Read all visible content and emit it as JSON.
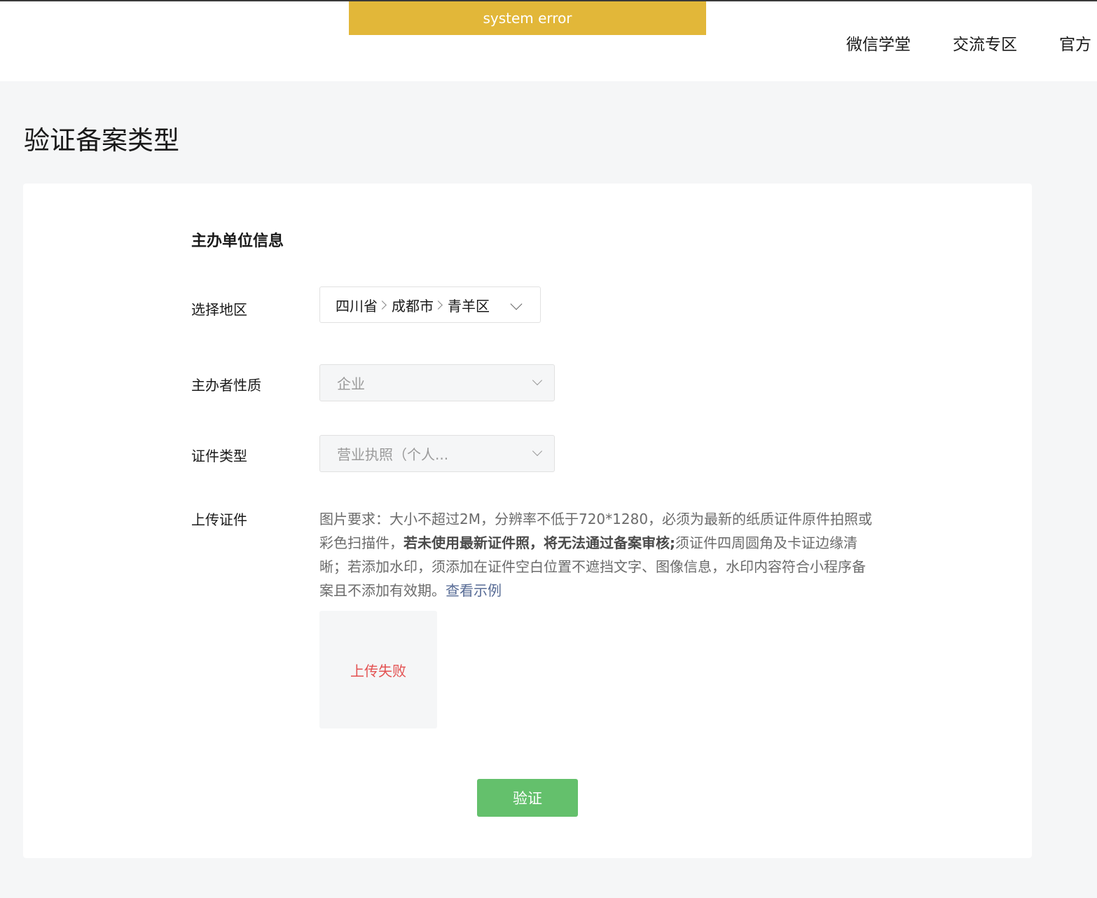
{
  "banner": {
    "text": "system error"
  },
  "nav": {
    "items": [
      "微信学堂",
      "交流专区",
      "官方"
    ]
  },
  "page": {
    "title": "验证备案类型"
  },
  "form": {
    "section_title": "主办单位信息",
    "region": {
      "label": "选择地区",
      "province": "四川省",
      "city": "成都市",
      "district": "青羊区"
    },
    "organizer_type": {
      "label": "主办者性质",
      "value": "企业"
    },
    "cert_type": {
      "label": "证件类型",
      "value": "营业执照（个人..."
    },
    "upload": {
      "label": "上传证件",
      "desc_part1": "图片要求：大小不超过2M，分辨率不低于720*1280，必须为最新的纸质证件原件拍照或彩色扫描件，",
      "desc_bold": "若未使用最新证件照，将无法通过备案审核;",
      "desc_part2": "须证件四周圆角及卡证边缘清晰；若添加水印，须添加在证件空白位置不遮挡文字、图像信息，水印内容符合小程序备案且不添加有效期。",
      "example_link": "查看示例",
      "status": "上传失败"
    },
    "submit_label": "验证"
  }
}
